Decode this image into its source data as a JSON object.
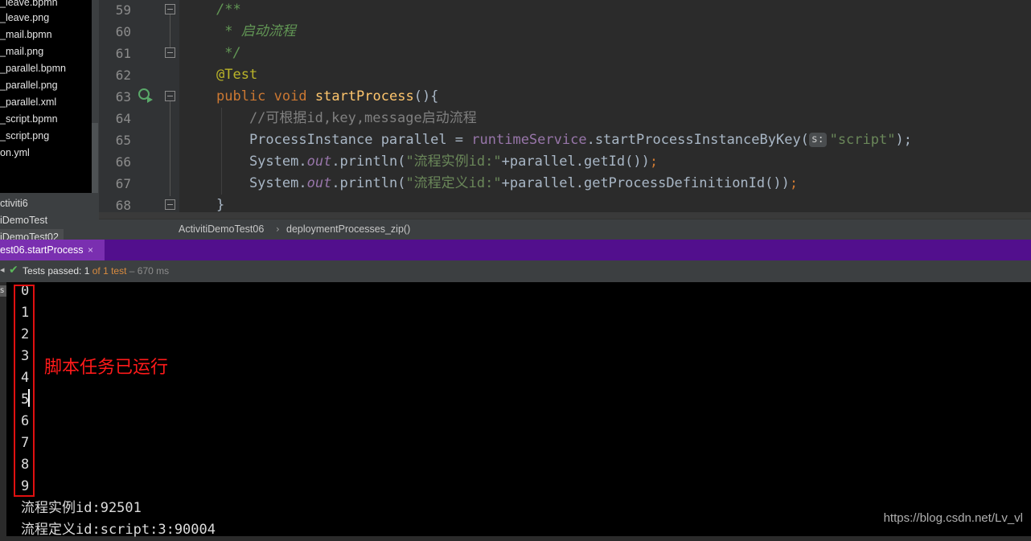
{
  "project_tree": {
    "files": [
      "_leave.bpmn",
      "_leave.png",
      "_mail.bpmn",
      "_mail.png",
      "_parallel.bpmn",
      "_parallel.png",
      "_parallel.xml",
      "_script.bpmn",
      "_script.png",
      "on.yml"
    ],
    "nodes": [
      "ctiviti6",
      "iDemoTest",
      "iDemoTest02"
    ]
  },
  "editor": {
    "line_numbers": [
      "59",
      "60",
      "61",
      "62",
      "63",
      "64",
      "65",
      "66",
      "67",
      "68"
    ],
    "lines": [
      [
        "/**"
      ],
      [
        " * 启动流程"
      ],
      [
        " */"
      ],
      [
        "@Test"
      ],
      [
        "public",
        " ",
        "void",
        " ",
        "startProcess",
        "(){"
      ],
      [
        "    //可根据id,key,message启动流程"
      ],
      [
        "    ProcessInstance parallel = ",
        "runtimeService",
        ".startProcessInstanceByKey(",
        "s:",
        "\"script\"",
        ");"
      ],
      [
        "    System.",
        "out",
        ".println(",
        "\"流程实例id:\"",
        "+parallel.getId())",
        ";"
      ],
      [
        "    System.",
        "out",
        ".println(",
        "\"流程定义id:\"",
        "+parallel.getProcessDefinitionId())",
        ";"
      ],
      [
        "}"
      ]
    ]
  },
  "breadcrumb": {
    "class_name": "ActivitiDemoTest06",
    "separator": "›",
    "method_name": "deploymentProcesses_zip()"
  },
  "run": {
    "tab_label": "est06.startProcess",
    "tab_close": "×",
    "status": {
      "prefix": "Tests passed: ",
      "passed": "1",
      "of": " of ",
      "total": "1 test",
      "duration": " – 670 ms"
    }
  },
  "console": {
    "lines": [
      "0",
      "1",
      "2",
      "3",
      "4",
      "5",
      "6",
      "7",
      "8",
      "9",
      "流程实例id:92501",
      "流程定义id:script:3:90004"
    ],
    "annotation": "脚本任务已运行",
    "tool_label": "s"
  },
  "watermark": "https://blog.csdn.net/Lv_vl",
  "colors": {
    "accent_tab": "#7a2fb0",
    "tab_bar": "#520f8d",
    "annotation_red": "#e01010"
  }
}
